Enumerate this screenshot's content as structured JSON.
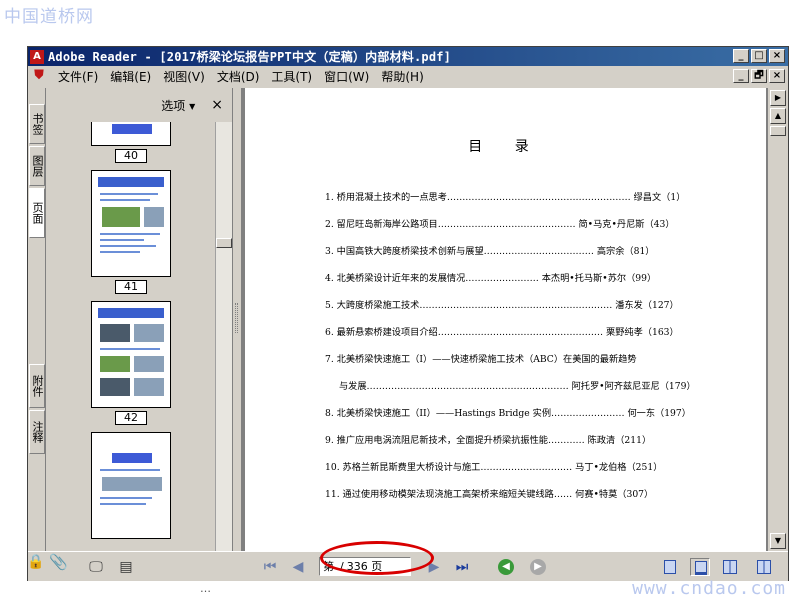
{
  "watermark_top": "中国道桥网",
  "watermark_bottom": "www.cndao.com",
  "footer_text": "…",
  "window": {
    "title": "Adobe Reader - [2017桥梁论坛报告PPT中文（定稿）内部材料.pdf]",
    "controls": {
      "minimize": "_",
      "maximize": "□",
      "close": "×",
      "restore": "🗗"
    }
  },
  "menubar": {
    "items": [
      "文件(F)",
      "编辑(E)",
      "视图(V)",
      "文档(D)",
      "工具(T)",
      "窗口(W)",
      "帮助(H)"
    ]
  },
  "nav_tabs": {
    "bookmarks": "书签",
    "layers": "图层",
    "pages": "页面",
    "attachments": "附件",
    "comments": "注释"
  },
  "panel": {
    "options_label": "选项",
    "close_label": "×",
    "thumbnails": [
      "40",
      "41",
      "42"
    ]
  },
  "document": {
    "toc_title": "目 录",
    "toc": [
      "1. 桥用混凝土技术的一点思考…………………………………………………… 缪昌文（1）",
      "2. 留尼旺岛新海岸公路项目……………………………………… 简•马克•丹尼斯（43）",
      "3. 中国高铁大跨度桥梁技术创新与展望……………………………… 高宗余（81）",
      "4. 北美桥梁设计近年来的发展情况…………………… 本杰明•托马斯•苏尔（99）",
      "5. 大跨度桥梁施工技术……………………………………………………… 潘东发（127）",
      "6. 最新悬索桥建设项目介绍……………………………………………… 栗野纯孝（163）",
      "7. 北美桥梁快速施工（I）——快速桥梁施工技术（ABC）在美国的最新趋势",
      "与发展………………………………………………………… 阿托罗•阿齐兹尼亚尼（179）",
      "8. 北美桥梁快速施工（II）——Hastings Bridge 实例…………………… 何一东（197）",
      "9. 推广应用电涡流阻尼新技术，全面提升桥梁抗振性能………… 陈政清（211）",
      "10. 苏格兰新昆斯费里大桥设计与施工………………………… 马丁•龙伯格（251）",
      "11. 通过使用移动模架法现浇施工高架桥来缩短关键线路…… 何赛•特莫（307）"
    ]
  },
  "statusbar": {
    "page_input": "第",
    "page_sep": "/",
    "page_total": "336 页"
  }
}
